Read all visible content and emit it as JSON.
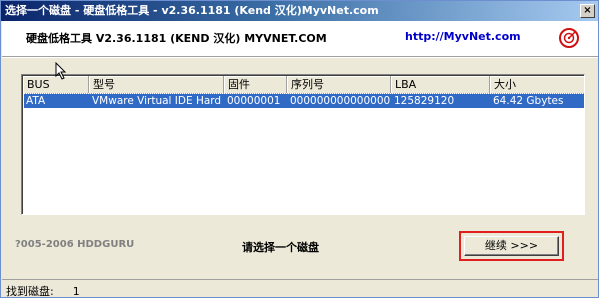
{
  "window": {
    "title": "选择一个磁盘 - 硬盘低格工具 - v2.36.1181 (Kend 汉化)MyvNet.com",
    "close_label": "×"
  },
  "header": {
    "app_heading": "硬盘低格工具 V2.36.1181 (KEND 汉化) MYVNET.COM",
    "site_link": "http://MyvNet.com",
    "logo_icon": "logo-icon"
  },
  "table": {
    "columns": [
      "BUS",
      "型号",
      "固件",
      "序列号",
      "LBA",
      "大小"
    ],
    "rows": [
      {
        "bus": "ATA",
        "model": "VMware Virtual IDE Hard",
        "firmware": "00000001",
        "serial": "000000000000000",
        "lba": "125829120",
        "size": "64.42 Gbytes"
      }
    ],
    "selected_row_color": "#316ac5"
  },
  "footer": {
    "copyright": "?005-2006 HDDGURU",
    "prompt": "请选择一个磁盘",
    "continue_label": "继续 >>>",
    "highlight_color": "#e21f1f"
  },
  "status": {
    "found_label": "找到磁盘:",
    "found_count": "1"
  }
}
